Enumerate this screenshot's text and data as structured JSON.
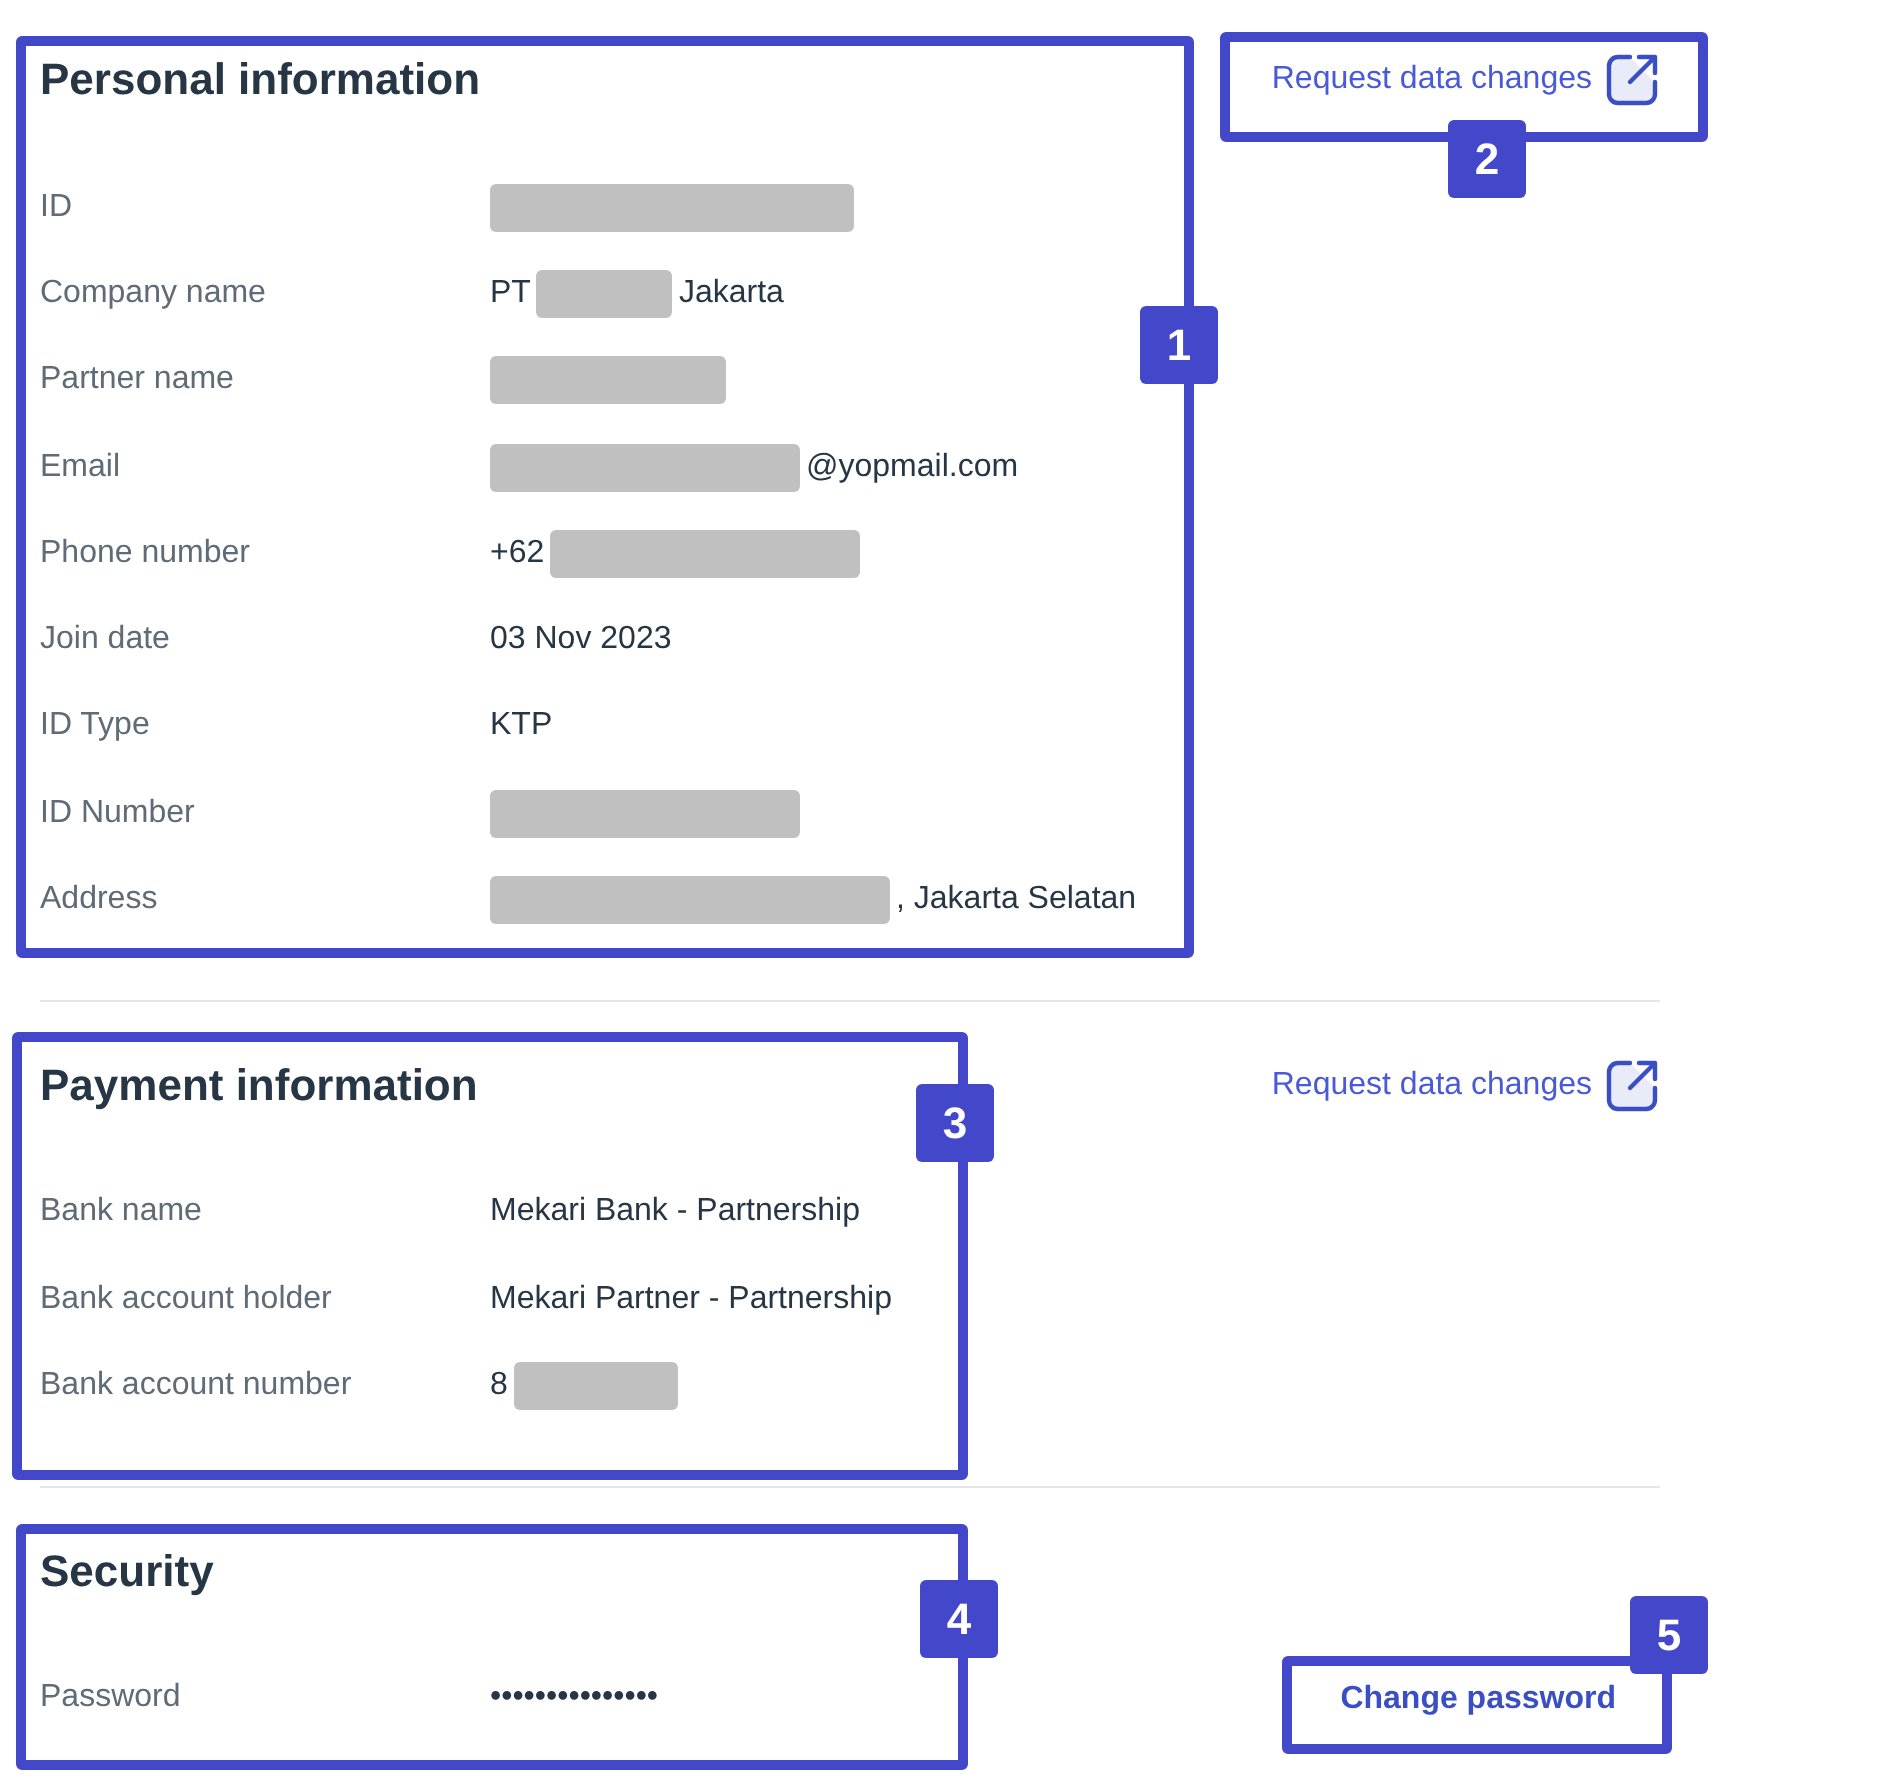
{
  "sections": [
    {
      "title": "Personal information",
      "action": {
        "kind": "link",
        "label": "Request data changes"
      },
      "rows": [
        {
          "label": "ID",
          "value": [
            {
              "kind": "redacted"
            }
          ]
        },
        {
          "label": "Company name",
          "value": [
            {
              "kind": "text",
              "text": "PT"
            },
            {
              "kind": "redacted"
            },
            {
              "kind": "text",
              "text": "Jakarta"
            }
          ]
        },
        {
          "label": "Partner name",
          "value": [
            {
              "kind": "redacted"
            }
          ]
        },
        {
          "label": "Email",
          "value": [
            {
              "kind": "redacted"
            },
            {
              "kind": "text",
              "text": "@yopmail.com"
            }
          ]
        },
        {
          "label": "Phone number",
          "value": [
            {
              "kind": "text",
              "text": "+62"
            },
            {
              "kind": "redacted"
            }
          ]
        },
        {
          "label": "Join date",
          "value": [
            {
              "kind": "text",
              "text": "03 Nov 2023"
            }
          ]
        },
        {
          "label": "ID Type",
          "value": [
            {
              "kind": "text",
              "text": "KTP"
            }
          ]
        },
        {
          "label": "ID Number",
          "value": [
            {
              "kind": "redacted"
            }
          ]
        },
        {
          "label": "Address",
          "value": [
            {
              "kind": "redacted"
            },
            {
              "kind": "text",
              "text": ", Jakarta Selatan"
            }
          ]
        }
      ]
    },
    {
      "title": "Payment information",
      "action": {
        "kind": "link",
        "label": "Request data changes"
      },
      "rows": [
        {
          "label": "Bank name",
          "value": [
            {
              "kind": "text",
              "text": "Mekari Bank - Partnership"
            }
          ]
        },
        {
          "label": "Bank account holder",
          "value": [
            {
              "kind": "text",
              "text": "Mekari Partner - Partnership"
            }
          ]
        },
        {
          "label": "Bank account number",
          "value": [
            {
              "kind": "text",
              "text": "8"
            },
            {
              "kind": "redacted"
            }
          ]
        }
      ]
    },
    {
      "title": "Security",
      "action": {
        "kind": "button",
        "label": "Change password"
      },
      "rows": [
        {
          "label": "Password",
          "value": [
            {
              "kind": "text",
              "text": "•••••••••••••••"
            }
          ]
        }
      ]
    }
  ],
  "annotations": [
    {
      "label": "1"
    },
    {
      "label": "2"
    },
    {
      "label": "3"
    },
    {
      "label": "4"
    },
    {
      "label": "5"
    }
  ]
}
